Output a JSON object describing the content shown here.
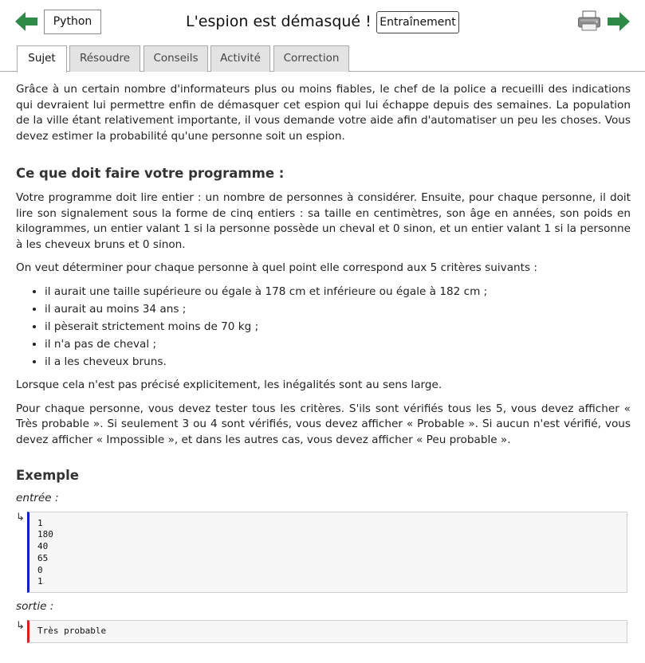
{
  "header": {
    "language": "Python",
    "title": "L'espion est démasqué !",
    "mode": "Entraînement",
    "colors": {
      "arrow": "#2e8b47",
      "input_bar": "#1020c8",
      "output_bar": "#d42020"
    },
    "icons": {
      "prev": "arrow-left-icon",
      "next": "arrow-right-icon",
      "print": "printer-icon"
    }
  },
  "tabs": [
    {
      "label": "Sujet",
      "active": true
    },
    {
      "label": "Résoudre",
      "active": false
    },
    {
      "label": "Conseils",
      "active": false
    },
    {
      "label": "Activité",
      "active": false
    },
    {
      "label": "Correction",
      "active": false
    }
  ],
  "content": {
    "intro": "Grâce à un certain nombre d'informateurs plus ou moins fiables, le chef de la police a recueilli des indications qui devraient lui permettre enfin de démasquer cet espion qui lui échappe depuis des semaines. La population de la ville étant relativement importante, il vous demande votre aide afin d'automatiser un peu les choses. Vous devez estimer la probabilité qu'une personne soit un espion.",
    "heading_task": "Ce que doit faire votre programme :",
    "task_p1": "Votre programme doit lire entier : un nombre de personnes à considérer. Ensuite, pour chaque personne, il doit lire son signalement sous la forme de cinq entiers : sa taille en centimètres, son âge en années, son poids en kilogrammes, un entier valant 1 si la personne possède un cheval et 0 sinon, et un entier valant 1 si la personne à les cheveux bruns et 0 sinon.",
    "task_p2": "On veut déterminer pour chaque personne à quel point elle correspond aux 5 critères suivants :",
    "criteria": [
      "il aurait une taille supérieure ou égale à 178 cm et inférieure ou égale à 182 cm ;",
      "il aurait au moins 34 ans ;",
      "il pèserait strictement moins de 70 kg ;",
      "il n'a pas de cheval ;",
      "il a les cheveux bruns."
    ],
    "task_p3": "Lorsque cela n'est pas précisé explicitement, les inégalités sont au sens large.",
    "task_p4": "Pour chaque personne, vous devez tester tous les critères. S'ils sont vérifiés tous les 5, vous devez afficher « Très probable ». Si seulement 3 ou 4 sont vérifiés, vous devez afficher « Probable ». Si aucun n'est vérifié, vous devez afficher « Impossible », et dans les autres cas, vous devez afficher « Peu probable ».",
    "heading_example": "Exemple",
    "input_label": "entrée :",
    "input_lines": [
      "1",
      "180",
      "40",
      "65",
      "0",
      "1"
    ],
    "output_label": "sortie :",
    "output_lines": [
      "Très probable"
    ],
    "io_icon": "↳"
  }
}
